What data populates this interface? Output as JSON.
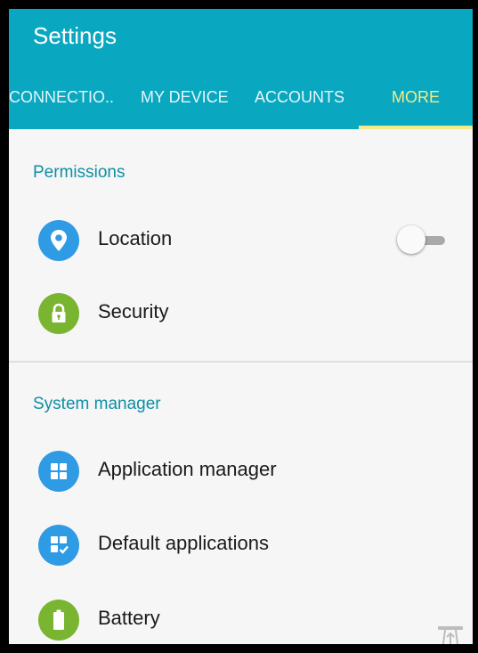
{
  "app": {
    "title": "Settings"
  },
  "tabs": [
    {
      "label": "CONNECTIO..",
      "active": false
    },
    {
      "label": "MY DEVICE",
      "active": false
    },
    {
      "label": "ACCOUNTS",
      "active": false
    },
    {
      "label": "MORE",
      "active": true
    }
  ],
  "sections": [
    {
      "header": "Permissions",
      "items": [
        {
          "label": "Location",
          "icon": "location-pin-icon",
          "icon_color": "#2f9be4",
          "toggle": {
            "on": false
          }
        },
        {
          "label": "Security",
          "icon": "lock-icon",
          "icon_color": "#79b531"
        }
      ]
    },
    {
      "header": "System manager",
      "items": [
        {
          "label": "Application manager",
          "icon": "grid-icon",
          "icon_color": "#2f9be4"
        },
        {
          "label": "Default applications",
          "icon": "grid-check-icon",
          "icon_color": "#2f9be4"
        },
        {
          "label": "Battery",
          "icon": "battery-icon",
          "icon_color": "#79b531"
        }
      ]
    }
  ],
  "colors": {
    "appbar": "#0aa8c0",
    "tab_active": "#f2eb8a",
    "section_header": "#0e8fa5",
    "background": "#f6f6f6"
  }
}
